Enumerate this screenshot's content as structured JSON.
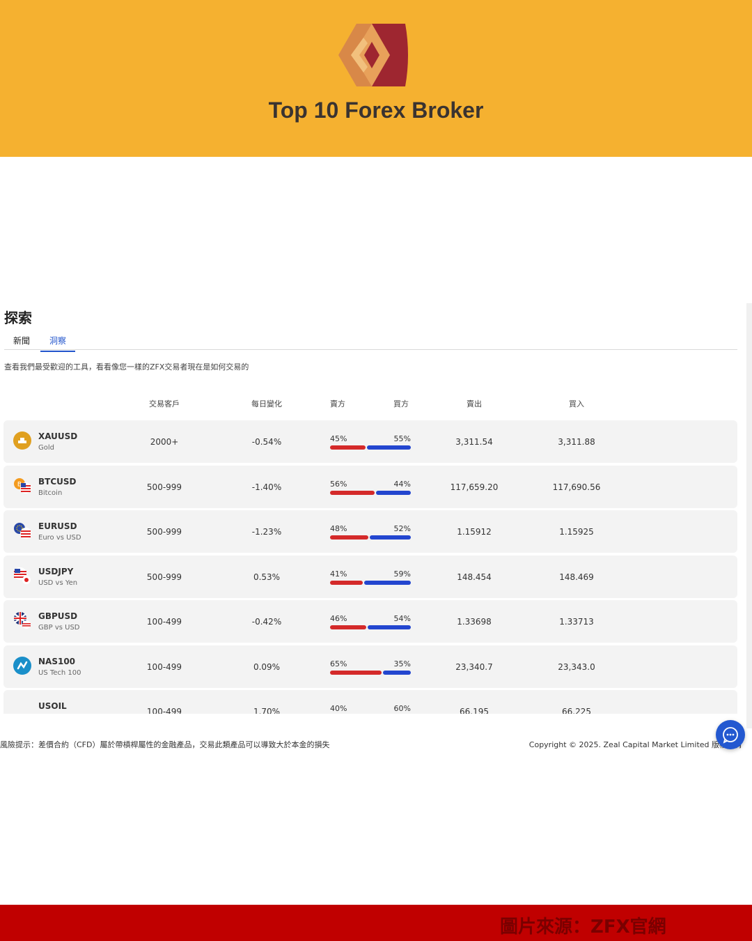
{
  "banner": {
    "title": "Top 10 Forex Broker",
    "background": "#f5b130"
  },
  "explore": {
    "title": "探索",
    "tabs": [
      {
        "label": "新聞",
        "active": false
      },
      {
        "label": "洞察",
        "active": true
      }
    ],
    "description": "查看我們最受歡迎的工具，看看像您一樣的ZFX交易者現在是如何交易的",
    "columns": {
      "clients": "交易客戶",
      "daily_change": "每日變化",
      "sellers": "賣方",
      "buyers": "買方",
      "sell": "賣出",
      "buy": "買入"
    },
    "rows": [
      {
        "symbol": "XAUUSD",
        "name": "Gold",
        "icon": "gold-icon",
        "clients": "2000+",
        "change": "-0.54%",
        "sell_pct": "45%",
        "buy_pct": "55%",
        "sell_frac": 0.45,
        "sell": "3,311.54",
        "buy": "3,311.88"
      },
      {
        "symbol": "BTCUSD",
        "name": "Bitcoin",
        "icon": "bitcoin-usd-flag-icon",
        "clients": "500-999",
        "change": "-1.40%",
        "sell_pct": "56%",
        "buy_pct": "44%",
        "sell_frac": 0.56,
        "sell": "117,659.20",
        "buy": "117,690.56"
      },
      {
        "symbol": "EURUSD",
        "name": "Euro vs USD",
        "icon": "eu-usd-flag-icon",
        "clients": "500-999",
        "change": "-1.23%",
        "sell_pct": "48%",
        "buy_pct": "52%",
        "sell_frac": 0.48,
        "sell": "1.15912",
        "buy": "1.15925"
      },
      {
        "symbol": "USDJPY",
        "name": "USD vs Yen",
        "icon": "usd-jpy-flag-icon",
        "clients": "500-999",
        "change": "0.53%",
        "sell_pct": "41%",
        "buy_pct": "59%",
        "sell_frac": 0.41,
        "sell": "148.454",
        "buy": "148.469"
      },
      {
        "symbol": "GBPUSD",
        "name": "GBP vs USD",
        "icon": "gbp-usd-flag-icon",
        "clients": "100-499",
        "change": "-0.42%",
        "sell_pct": "46%",
        "buy_pct": "54%",
        "sell_frac": 0.46,
        "sell": "1.33698",
        "buy": "1.33713"
      },
      {
        "symbol": "NAS100",
        "name": "US Tech 100",
        "icon": "nasdaq-icon",
        "clients": "100-499",
        "change": "0.09%",
        "sell_pct": "65%",
        "buy_pct": "35%",
        "sell_frac": 0.65,
        "sell": "23,340.7",
        "buy": "23,343.0"
      },
      {
        "symbol": "USOIL",
        "name": "",
        "icon": "",
        "clients": "100-499",
        "change": "1.70%",
        "sell_pct": "40%",
        "buy_pct": "60%",
        "sell_frac": 0.4,
        "sell": "66.195",
        "buy": "66.225"
      }
    ],
    "colors": {
      "sell_bar": "#d42a2a",
      "buy_bar": "#2346cf",
      "active_tab": "#2255cc"
    }
  },
  "footer": {
    "risk_warning": "風險提示：差價合約（CFD）屬於帶槓桿屬性的金融產品，交易此類產品可以導致大於本金的損失",
    "copyright": "Copyright © 2025. Zeal Capital Market Limited 版權所有"
  },
  "bottom_band": {
    "watermark": "圖片來源：ZFX官網",
    "background": "#c00000"
  }
}
